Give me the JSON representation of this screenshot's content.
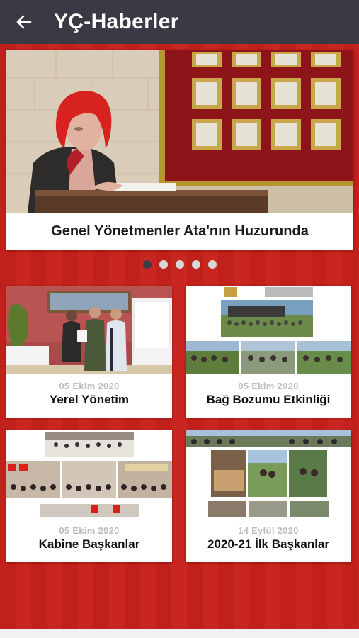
{
  "app_bar": {
    "title": "YÇ-Haberler"
  },
  "slider": {
    "caption": "Genel Yönetmenler Ata'nın Huzurunda",
    "dots": 5,
    "active_dot": 0
  },
  "news": [
    {
      "date": "05 Ekim 2020",
      "title": "Yerel Yönetim"
    },
    {
      "date": "05 Ekim 2020",
      "title": "Bağ Bozumu Etkinliği"
    },
    {
      "date": "05 Ekim 2020",
      "title": "Kabine Başkanlar"
    },
    {
      "date": "14 Eylül 2020",
      "title": "2020-21 İlk Başkanlar"
    }
  ],
  "colors": {
    "app_bar": "#3a3a45",
    "background": "#c8211d",
    "card": "#ffffff",
    "date_text": "#bdbdbd",
    "dot_active": "#3d3d48",
    "dot_inactive": "#d7d7d7"
  },
  "icons": {
    "back": "arrow-left-icon"
  }
}
